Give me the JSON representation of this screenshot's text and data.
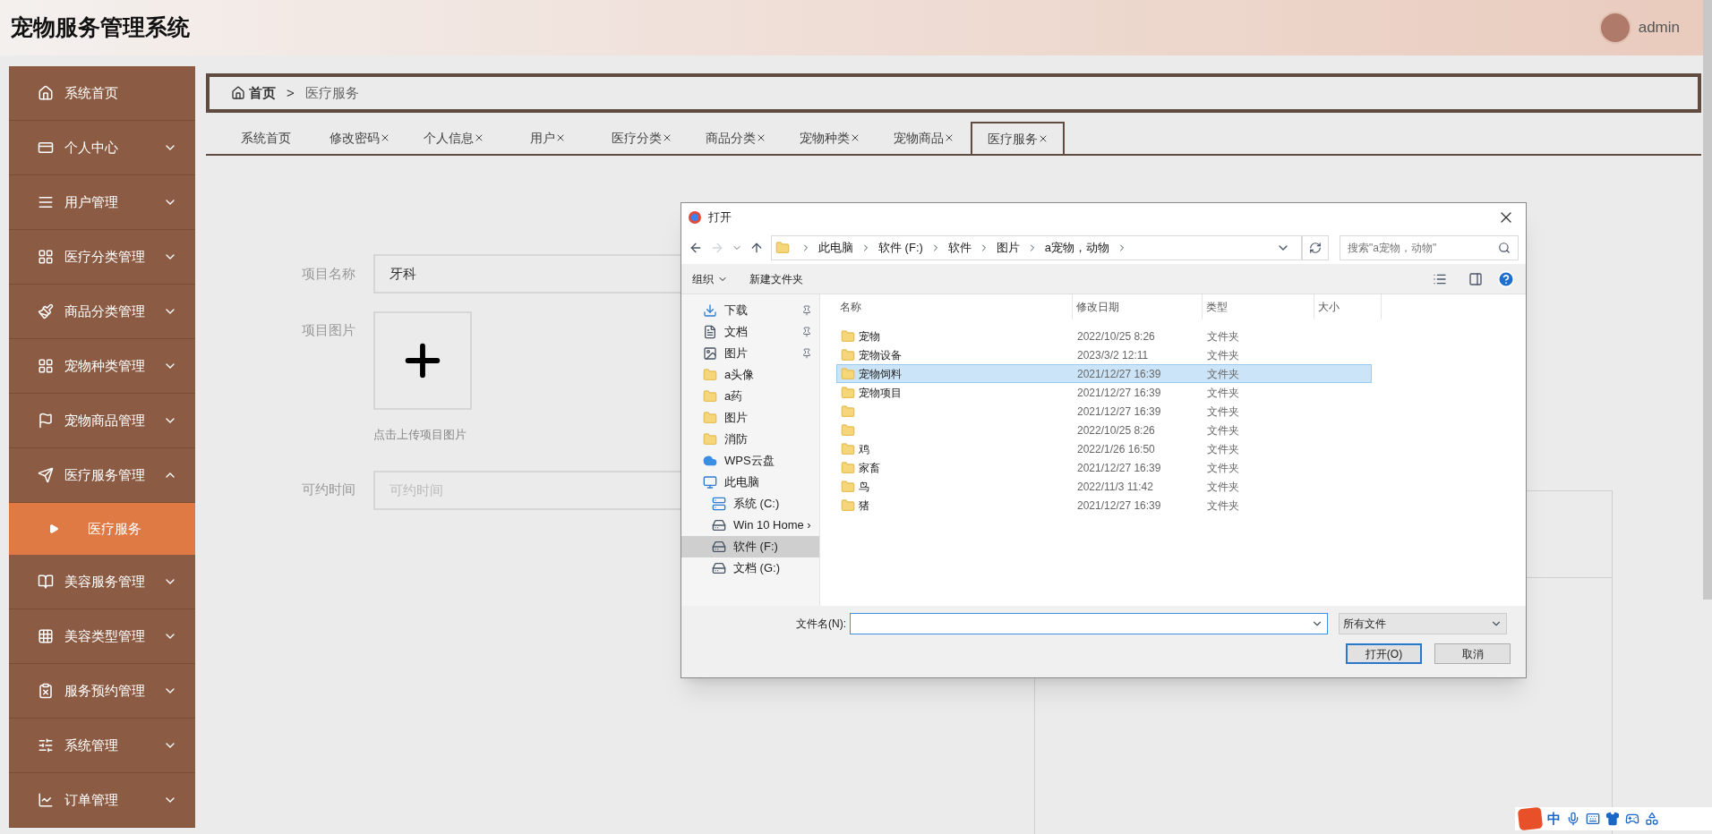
{
  "header": {
    "title": "宠物服务管理系统",
    "user": "admin"
  },
  "sidebar": {
    "items": [
      {
        "label": "系统首页",
        "expandable": false,
        "expanded": false,
        "selected": false
      },
      {
        "label": "个人中心",
        "expandable": true,
        "expanded": false,
        "selected": false
      },
      {
        "label": "用户管理",
        "expandable": true,
        "expanded": false,
        "selected": false
      },
      {
        "label": "医疗分类管理",
        "expandable": true,
        "expanded": false,
        "selected": false
      },
      {
        "label": "商品分类管理",
        "expandable": true,
        "expanded": false,
        "selected": false
      },
      {
        "label": "宠物种类管理",
        "expandable": true,
        "expanded": false,
        "selected": false
      },
      {
        "label": "宠物商品管理",
        "expandable": true,
        "expanded": false,
        "selected": false
      },
      {
        "label": "医疗服务管理",
        "expandable": true,
        "expanded": true,
        "selected": false,
        "children": [
          {
            "label": "医疗服务",
            "selected": true
          }
        ]
      },
      {
        "label": "美容服务管理",
        "expandable": true,
        "expanded": false,
        "selected": false
      },
      {
        "label": "美容类型管理",
        "expandable": true,
        "expanded": false,
        "selected": false
      },
      {
        "label": "服务预约管理",
        "expandable": true,
        "expanded": false,
        "selected": false
      },
      {
        "label": "系统管理",
        "expandable": true,
        "expanded": false,
        "selected": false
      },
      {
        "label": "订单管理",
        "expandable": true,
        "expanded": false,
        "selected": false
      }
    ]
  },
  "breadcrumb": {
    "home": "首页",
    "separator": ">",
    "current": "医疗服务"
  },
  "tabs": [
    {
      "label": "系统首页",
      "closable": false,
      "selected": false
    },
    {
      "label": "修改密码",
      "closable": true,
      "selected": false
    },
    {
      "label": "个人信息",
      "closable": true,
      "selected": false
    },
    {
      "label": "用户",
      "closable": true,
      "selected": false
    },
    {
      "label": "医疗分类",
      "closable": true,
      "selected": false
    },
    {
      "label": "商品分类",
      "closable": true,
      "selected": false
    },
    {
      "label": "宠物种类",
      "closable": true,
      "selected": false
    },
    {
      "label": "宠物商品",
      "closable": true,
      "selected": false
    },
    {
      "label": "医疗服务",
      "closable": true,
      "selected": true
    }
  ],
  "form": {
    "name_label": "项目名称",
    "name_value": "牙科",
    "image_label": "项目图片",
    "image_hint": "点击上传项目图片",
    "time_label": "可约时间",
    "time_placeholder": "可约时间"
  },
  "dialog": {
    "title": "打开",
    "path": [
      "此电脑",
      "软件 (F:)",
      "软件",
      "图片",
      "a宠物，动物"
    ],
    "search_placeholder": "搜索\"a宠物，动物\"",
    "toolbar": {
      "organize": "组织",
      "new_folder": "新建文件夹"
    },
    "nav": [
      {
        "label": "下载",
        "kind": "download",
        "pinned": true,
        "selected": false
      },
      {
        "label": "文档",
        "kind": "document",
        "pinned": true,
        "selected": false
      },
      {
        "label": "图片",
        "kind": "picture",
        "pinned": true,
        "selected": false
      },
      {
        "label": "a头像",
        "kind": "folder",
        "pinned": false,
        "selected": false
      },
      {
        "label": "a药",
        "kind": "folder",
        "pinned": false,
        "selected": false
      },
      {
        "label": "图片",
        "kind": "folder",
        "pinned": false,
        "selected": false
      },
      {
        "label": "消防",
        "kind": "folder",
        "pinned": false,
        "selected": false
      },
      {
        "label": "WPS云盘",
        "kind": "cloud",
        "pinned": false,
        "selected": false
      },
      {
        "label": "此电脑",
        "kind": "pc",
        "pinned": false,
        "selected": false,
        "children": [
          {
            "label": "系统 (C:)",
            "kind": "system-drive",
            "selected": false
          },
          {
            "label": "Win 10 Home ›",
            "kind": "drive",
            "selected": false
          },
          {
            "label": "软件 (F:)",
            "kind": "drive",
            "selected": true
          },
          {
            "label": "文档 (G:)",
            "kind": "drive",
            "selected": false
          }
        ]
      }
    ],
    "columns": [
      "名称",
      "修改日期",
      "类型",
      "大小"
    ],
    "files": [
      {
        "name": "宠物",
        "date": "2022/10/25 8:26",
        "type": "文件夹",
        "selected": false
      },
      {
        "name": "宠物设备",
        "date": "2023/3/2 12:11",
        "type": "文件夹",
        "selected": false
      },
      {
        "name": "宠物饲料",
        "date": "2021/12/27 16:39",
        "type": "文件夹",
        "selected": true
      },
      {
        "name": "宠物项目",
        "date": "2021/12/27 16:39",
        "type": "文件夹",
        "selected": false
      },
      {
        "date": "2021/12/27 16:39",
        "type": "文件夹",
        "selected": false
      },
      {
        "date": "2022/10/25 8:26",
        "type": "文件夹",
        "selected": false
      },
      {
        "name": "鸡",
        "date": "2022/1/26 16:50",
        "type": "文件夹",
        "selected": false
      },
      {
        "name": "家畜",
        "date": "2021/12/27 16:39",
        "type": "文件夹",
        "selected": false
      },
      {
        "name": "鸟",
        "date": "2022/11/3 11:42",
        "type": "文件夹",
        "selected": false
      },
      {
        "name": "猪",
        "date": "2021/12/27 16:39",
        "type": "文件夹",
        "selected": false
      }
    ],
    "filename_label": "文件名(N):",
    "filter": "所有文件",
    "open_button": "打开(O)",
    "cancel_button": "取消"
  },
  "ime": {
    "mode": "中"
  }
}
